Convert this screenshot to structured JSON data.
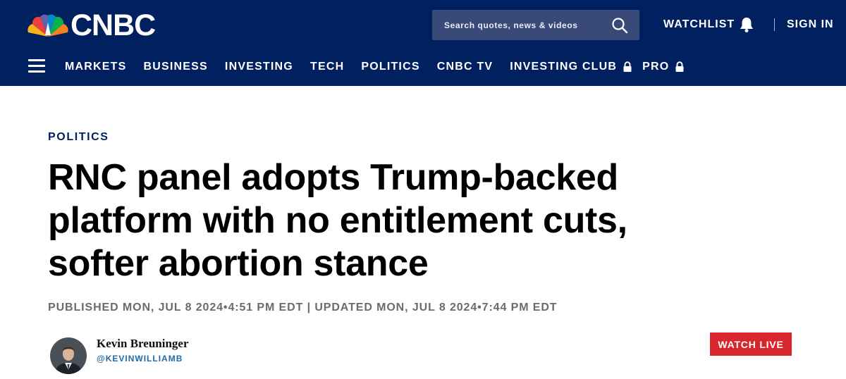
{
  "header": {
    "logo_text": "CNBC",
    "search_placeholder": "Search quotes, news & videos",
    "watchlist_label": "WATCHLIST",
    "signin_label": "SIGN IN",
    "bg_color": "#002060"
  },
  "nav": {
    "items": [
      {
        "label": "MARKETS"
      },
      {
        "label": "BUSINESS"
      },
      {
        "label": "INVESTING"
      },
      {
        "label": "TECH"
      },
      {
        "label": "POLITICS"
      },
      {
        "label": "CNBC TV"
      },
      {
        "label": "INVESTING CLUB",
        "icon": "lock-icon"
      },
      {
        "label": "PRO",
        "icon": "lock-icon"
      }
    ]
  },
  "article": {
    "section": "POLITICS",
    "headline_lines": [
      "RNC panel adopts Trump-backed",
      "platform with no entitlement cuts,",
      "softer abortion stance"
    ],
    "timestamp": "PUBLISHED MON, JUL 8 2024•4:51 PM EDT | UPDATED MON, JUL 8 2024•7:44 PM EDT",
    "author_name": "Kevin Breuninger",
    "author_handle": "@KEVINWILLIAMB"
  },
  "watch_live_label": "WATCH LIVE",
  "colors": {
    "accent_red": "#d6262e",
    "kicker_blue": "#002060",
    "handle_blue": "#1f6ba8"
  }
}
